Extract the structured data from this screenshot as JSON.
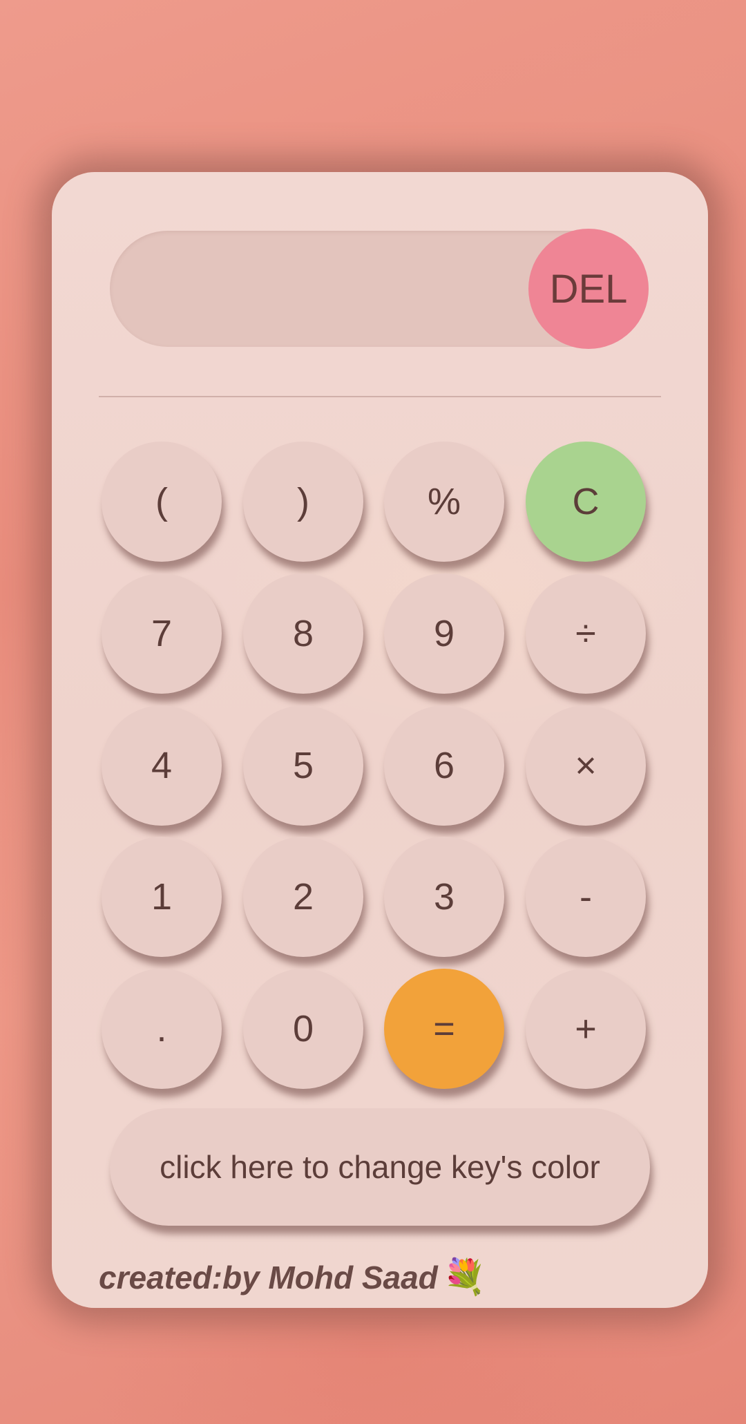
{
  "display": {
    "value": "",
    "del_label": "DEL"
  },
  "keys": [
    {
      "label": "(",
      "style": "normal"
    },
    {
      "label": ")",
      "style": "normal"
    },
    {
      "label": "%",
      "style": "normal"
    },
    {
      "label": "C",
      "style": "green"
    },
    {
      "label": "7",
      "style": "normal"
    },
    {
      "label": "8",
      "style": "normal"
    },
    {
      "label": "9",
      "style": "normal"
    },
    {
      "label": "÷",
      "style": "normal"
    },
    {
      "label": "4",
      "style": "normal"
    },
    {
      "label": "5",
      "style": "normal"
    },
    {
      "label": "6",
      "style": "normal"
    },
    {
      "label": "×",
      "style": "normal"
    },
    {
      "label": "1",
      "style": "normal"
    },
    {
      "label": "2",
      "style": "normal"
    },
    {
      "label": "3",
      "style": "normal"
    },
    {
      "label": "-",
      "style": "normal"
    },
    {
      "label": ".",
      "style": "normal"
    },
    {
      "label": "0",
      "style": "normal"
    },
    {
      "label": "=",
      "style": "orange"
    },
    {
      "label": "+",
      "style": "normal"
    }
  ],
  "change_color_label": "click here to change key's color",
  "credit": {
    "text": "created:by Mohd Saad",
    "icon": "bouquet-icon",
    "glyph": "💐"
  },
  "colors": {
    "del": "#ef8595",
    "clear": "#a9d38f",
    "equals": "#f2a23a",
    "key": "#e9cdc7"
  }
}
